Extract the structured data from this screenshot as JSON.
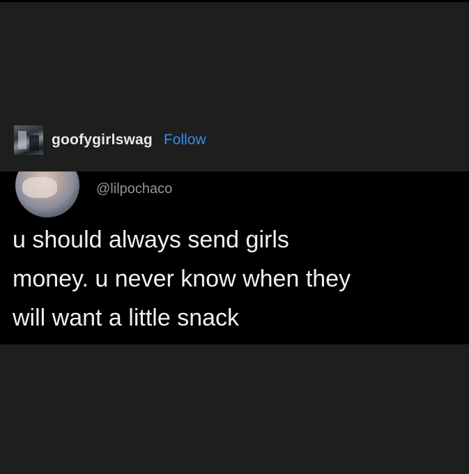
{
  "post": {
    "username": "goofygirlswag",
    "follow_label": "Follow"
  },
  "tweet": {
    "handle": "@lilpochaco",
    "text": "u should always send girls\nmoney. u never know when they\nwill want a little snack"
  },
  "colors": {
    "background": "#1e1e1f",
    "tweet_background": "#000000",
    "follow_accent": "#2f8fe8",
    "handle_gray": "#8e959c"
  }
}
